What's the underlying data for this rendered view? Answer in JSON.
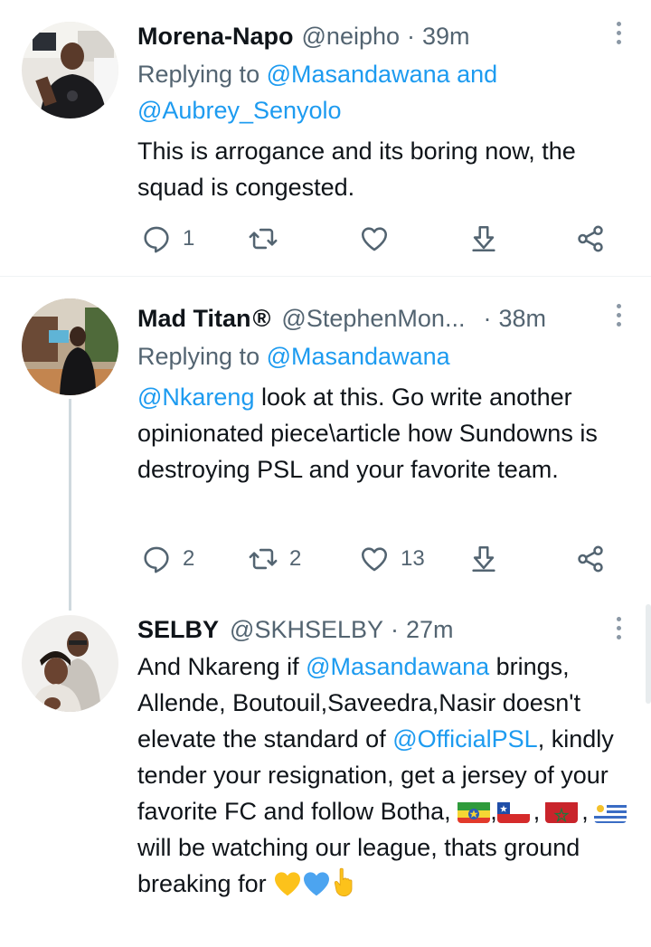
{
  "tweets": [
    {
      "name": "Morena-Napo",
      "handle": "@neipho",
      "separator": "·",
      "time": "39m",
      "replying_prefix": "Replying to ",
      "replying_to_1": "@Masandawana",
      "replying_joiner": " and",
      "replying_to_2": "@Aubrey_Senyolo",
      "text": "This is arrogance and its boring now, the squad is congested.",
      "replies": "1",
      "retweets": "",
      "likes": ""
    },
    {
      "name": "Mad Titan",
      "verified_mark": "®",
      "handle": "@StephenMon...",
      "separator": "·",
      "time": "38m",
      "replying_prefix": "Replying to ",
      "replying_to_1": "@Masandawana",
      "mention": "@Nkareng",
      "text": " look at this. Go write another opinionated piece\\article how Sundowns is destroying PSL and your favorite team.",
      "replies": "2",
      "retweets": "2",
      "likes": "13"
    },
    {
      "name": "SELBY",
      "handle": "@SKHSELBY",
      "separator": "·",
      "time": "27m",
      "text_1": "And Nkareng if ",
      "mention_1": "@Masandawana",
      "text_2": " brings, Allende, Boutouil,Saveedra,Nasir doesn't elevate the standard of ",
      "mention_2": "@OfficialPSL",
      "text_3": ", kindly tender your resignation, get a jersey of your favorite FC and follow Botha, ",
      "flag_sep": ",",
      "text_4": " will be watching our league, thats ground breaking for "
    }
  ],
  "icons": {
    "reply": "reply-icon",
    "retweet": "retweet-icon",
    "like": "heart-icon",
    "bookmark": "bookmark-icon",
    "share": "share-icon",
    "more": "more-options-icon"
  },
  "colors": {
    "link": "#1d9bf0",
    "secondary_text": "#536471",
    "thread_line": "#cfd9de"
  }
}
